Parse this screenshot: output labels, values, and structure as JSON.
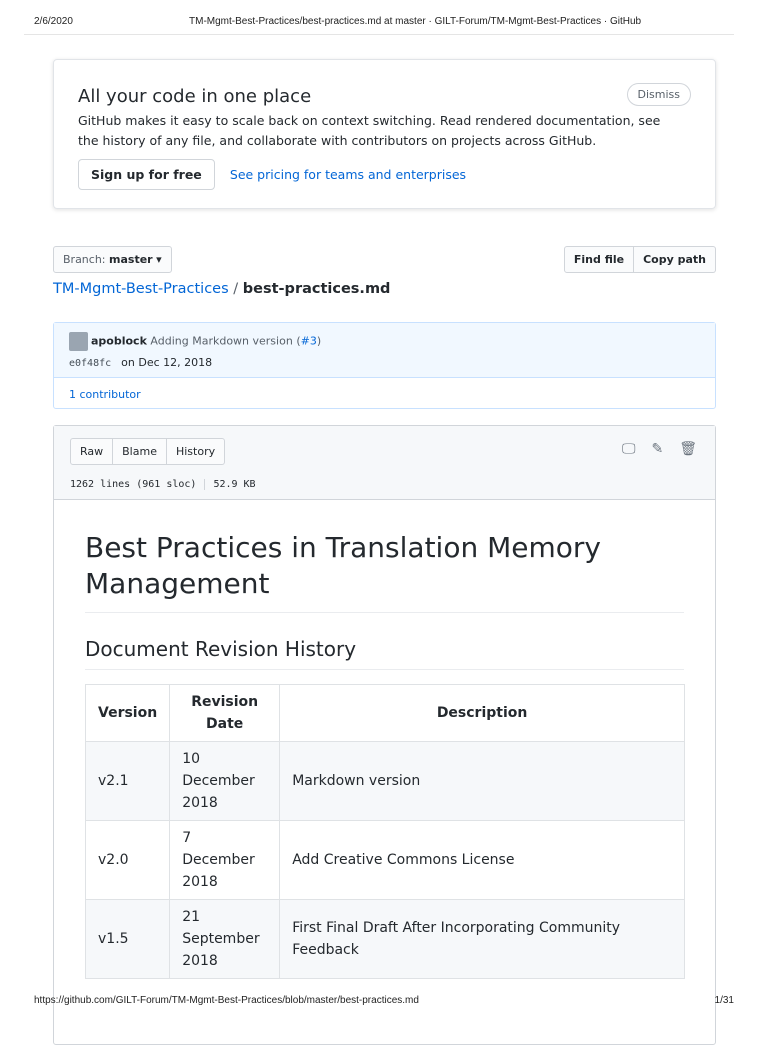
{
  "header": {
    "date": "2/6/2020",
    "title": "TM-Mgmt-Best-Practices/best-practices.md at master · GILT-Forum/TM-Mgmt-Best-Practices · GitHub"
  },
  "banner": {
    "title": "All your code in one place",
    "text": "GitHub makes it easy to scale back on context switching. Read rendered documentation, see the history of any file, and collaborate with contributors on projects across GitHub.",
    "dismiss": "Dismiss",
    "signup": "Sign up for free",
    "pricing": "See pricing for teams and enterprises"
  },
  "branch": {
    "label": "Branch:",
    "value": "master"
  },
  "file_buttons": {
    "find": "Find file",
    "copy": "Copy path"
  },
  "breadcrumb": {
    "repo": "TM-Mgmt-Best-Practices",
    "sep": "/",
    "file": "best-practices.md"
  },
  "commit": {
    "author": "apoblock",
    "message": "Adding Markdown version",
    "pr_open": "(",
    "pr": "#3",
    "pr_close": ")",
    "sha": "e0f48fc",
    "date": "on Dec 12, 2018",
    "contributors": "1 contributor"
  },
  "file": {
    "raw": "Raw",
    "blame": "Blame",
    "history": "History",
    "lines": "1262 lines (961 sloc)",
    "size": "52.9 KB"
  },
  "doc": {
    "h1": "Best Practices in Translation Memory Management",
    "h2": "Document Revision History",
    "headers": [
      "Version",
      "Revision Date",
      "Description"
    ],
    "rows": [
      [
        "v2.1",
        "10 December 2018",
        "Markdown version"
      ],
      [
        "v2.0",
        "7 December 2018",
        "Add Creative Commons License"
      ],
      [
        "v1.5",
        "21 September 2018",
        "First Final Draft After Incorporating Community Feedback"
      ]
    ]
  },
  "footer": {
    "url": "https://github.com/GILT-Forum/TM-Mgmt-Best-Practices/blob/master/best-practices.md",
    "page": "1/31"
  }
}
